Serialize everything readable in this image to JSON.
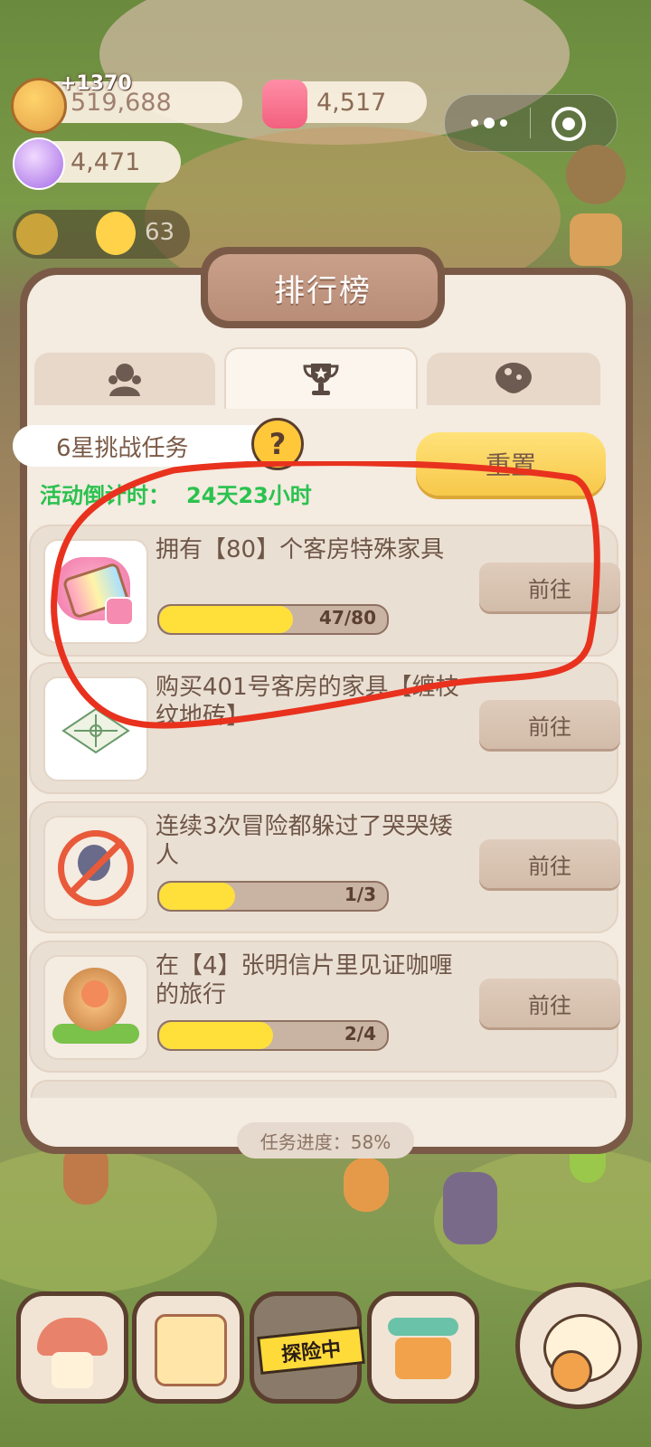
{
  "top_bar": {
    "gold_gain": "+1370",
    "gold_value": "519,688",
    "candy_value": "4,517",
    "gem_value": "4,471",
    "pet_count": "63"
  },
  "panel": {
    "title": "排行榜",
    "tabs": [
      "person-tab",
      "trophy-tab",
      "mushroom-tab"
    ],
    "active_tab_index": 1
  },
  "challenge": {
    "title": "6星挑战任务",
    "help": "?",
    "reset_label": "重置",
    "countdown_label": "活动倒计时：",
    "countdown_value": "24天23小时"
  },
  "tasks": [
    {
      "title": "拥有【80】个客房特殊家具",
      "progress_text": "47/80",
      "progress": 0.5875,
      "button": "前往",
      "icon": "furniture-icon"
    },
    {
      "title": "购买401号客房的家具【缠枝纹地砖】",
      "progress_text": "",
      "progress": null,
      "button": "前往",
      "icon": "floor-tile-icon"
    },
    {
      "title": "连续3次冒险都躲过了哭哭矮人",
      "progress_text": "1/3",
      "progress": 0.3333,
      "button": "前往",
      "icon": "no-crying-dwarf-icon"
    },
    {
      "title": "在【4】张明信片里见证咖喱的旅行",
      "progress_text": "2/4",
      "progress": 0.5,
      "button": "前往",
      "icon": "curry-character-icon"
    }
  ],
  "footer": {
    "task_progress": "任务进度：58%"
  },
  "bottom_nav": {
    "explore_label": "探险中"
  },
  "colors": {
    "panel_border": "#7a5a46",
    "progress_fill": "#ffe03a",
    "countdown": "#2bc24f",
    "annotation": "#e8321e"
  }
}
